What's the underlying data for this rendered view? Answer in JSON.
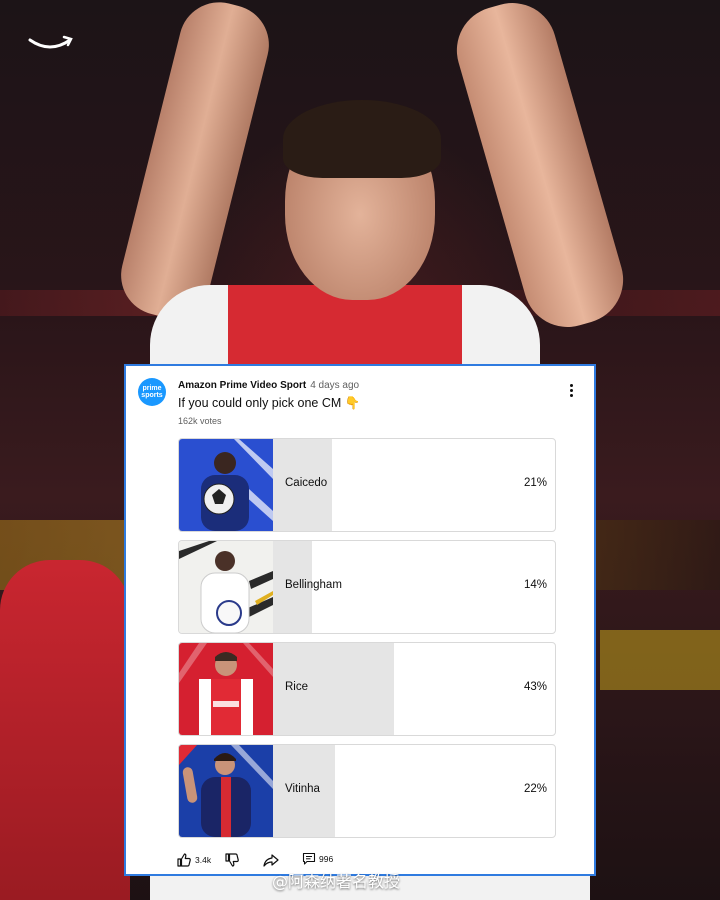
{
  "post": {
    "avatar_text_top": "prime",
    "avatar_text_bottom": "sports",
    "channel_name": "Amazon Prime Video Sport",
    "time_ago": "4 days ago",
    "question": "If you could only pick one CM 👇",
    "votes": "162k votes"
  },
  "poll": {
    "options": [
      {
        "name": "Caicedo",
        "percent": "21%",
        "fraction": 0.21,
        "thumb_bg": "#2a4fd0",
        "kit_color": "#1b2d7a"
      },
      {
        "name": "Bellingham",
        "percent": "14%",
        "fraction": 0.14,
        "thumb_bg": "#f1f1ee",
        "kit_color": "#ffffff"
      },
      {
        "name": "Rice",
        "percent": "43%",
        "fraction": 0.43,
        "thumb_bg": "#d52030",
        "kit_color": "#e12a35"
      },
      {
        "name": "Vitinha",
        "percent": "22%",
        "fraction": 0.22,
        "thumb_bg": "#1b3fa8",
        "kit_color": "#1a2566"
      }
    ]
  },
  "actions": {
    "likes": "3.4k",
    "comments": "996"
  },
  "watermark": "@阿森纳著名教授",
  "colors": {
    "card_border": "#2f7be0",
    "poll_fill": "#e5e5e5",
    "avatar_bg": "#1a98ff"
  }
}
